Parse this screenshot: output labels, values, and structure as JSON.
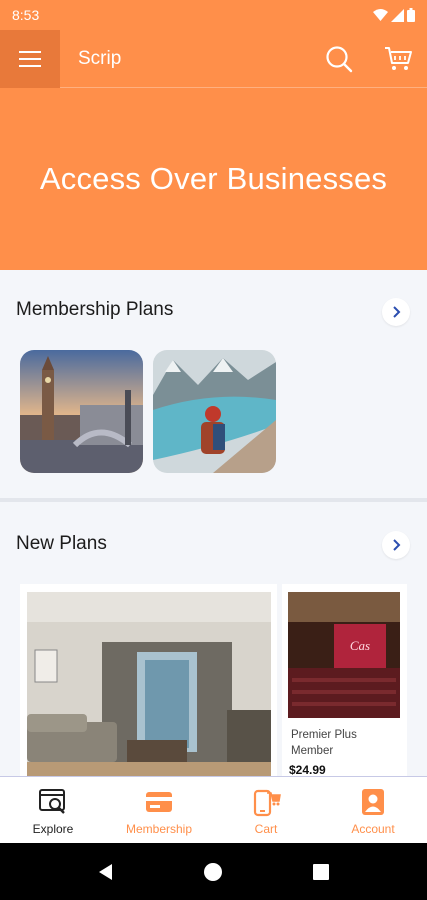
{
  "status_bar": {
    "time": "8:53"
  },
  "app_bar": {
    "title": "Scrip"
  },
  "hero": {
    "text": "Access Over Businesses"
  },
  "membership_plans": {
    "title": "Membership Plans",
    "items": [
      {
        "image": "london-big-ben-photo"
      },
      {
        "image": "mountain-lake-hiker-photo"
      }
    ]
  },
  "new_plans": {
    "title": "New Plans",
    "items": [
      {
        "image": "living-room-photo"
      },
      {
        "image": "theater-photo",
        "name": "Premier Plus Member",
        "price": "$24.99"
      }
    ]
  },
  "bottom_nav": {
    "items": [
      {
        "label": "Explore",
        "icon": "explore-icon",
        "color": "#222222"
      },
      {
        "label": "Membership",
        "icon": "membership-card-icon",
        "color": "#ff8f4a"
      },
      {
        "label": "Cart",
        "icon": "cart-icon",
        "color": "#ff8f4a"
      },
      {
        "label": "Account",
        "icon": "account-icon",
        "color": "#ff8f4a"
      }
    ]
  },
  "colors": {
    "accent": "#ff8f4a",
    "background": "#f4f6fa"
  }
}
